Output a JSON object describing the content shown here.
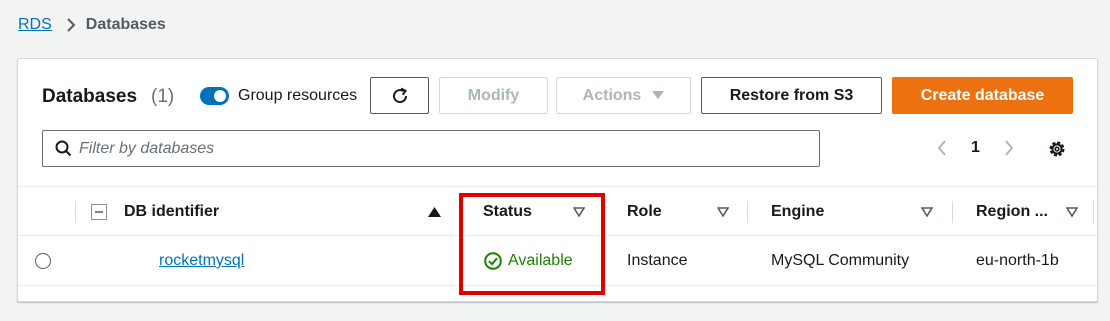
{
  "breadcrumb": {
    "root": "RDS",
    "current": "Databases"
  },
  "panel": {
    "title": "Databases",
    "count": "(1)",
    "group_toggle_label": "Group resources",
    "group_toggle_on": true,
    "buttons": {
      "modify": "Modify",
      "actions": "Actions",
      "restore": "Restore from S3",
      "create": "Create database"
    },
    "filter_placeholder": "Filter by databases",
    "pagination": {
      "current_page": "1"
    }
  },
  "table": {
    "columns": {
      "identifier": "DB identifier",
      "status": "Status",
      "role": "Role",
      "engine": "Engine",
      "region": "Region ..."
    },
    "rows": [
      {
        "identifier": "rocketmysql",
        "status": "Available",
        "role": "Instance",
        "engine": "MySQL Community",
        "region": "eu-north-1b"
      }
    ]
  },
  "colors": {
    "link": "#0073bb",
    "primary": "#ec7211",
    "success": "#1d8102",
    "highlight": "#e00000"
  },
  "icons": [
    "chevron-right-icon",
    "refresh-icon",
    "caret-down-icon",
    "search-icon",
    "chevron-left-icon",
    "gear-icon",
    "sort-ascending-icon",
    "filter-caret-icon",
    "status-success-icon",
    "collapse-icon"
  ]
}
